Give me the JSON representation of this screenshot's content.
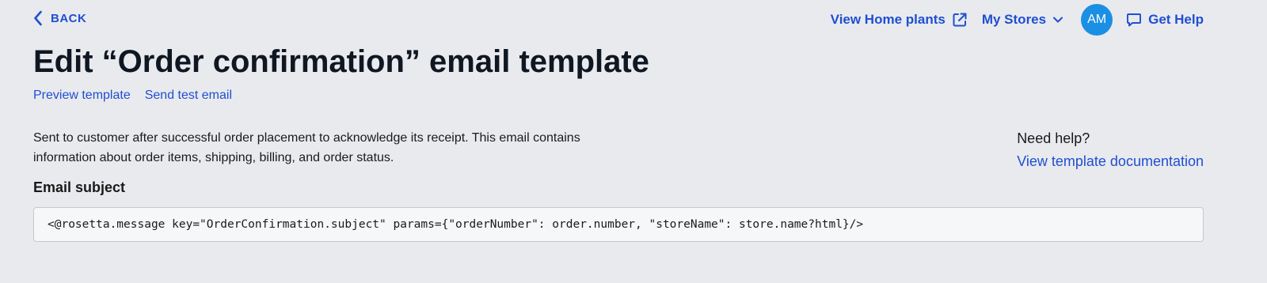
{
  "header": {
    "back_label": "BACK",
    "view_store_label": "View Home plants",
    "stores_label": "My Stores",
    "avatar_initials": "AM",
    "help_label": "Get Help"
  },
  "page": {
    "title": "Edit “Order confirmation” email template",
    "preview_label": "Preview template",
    "send_test_label": "Send test email",
    "description": "Sent to customer after successful order placement to acknowledge its receipt. This email contains information about order items, shipping, billing, and order status."
  },
  "help": {
    "title": "Need help?",
    "link_label": "View template documentation"
  },
  "subject": {
    "label": "Email subject",
    "value": "<@rosetta.message key=\"OrderConfirmation.subject\" params={\"orderNumber\": order.number, \"storeName\": store.name?html}/>"
  },
  "colors": {
    "accent": "#1f4fd1",
    "avatar": "#1b8fe3",
    "background": "#e9eaee",
    "field_background": "#f6f7f9"
  },
  "icons": {
    "back": "chevron-left-icon",
    "external": "external-link-icon",
    "stores_dropdown": "chevron-down-icon",
    "help": "chat-bubble-icon"
  }
}
